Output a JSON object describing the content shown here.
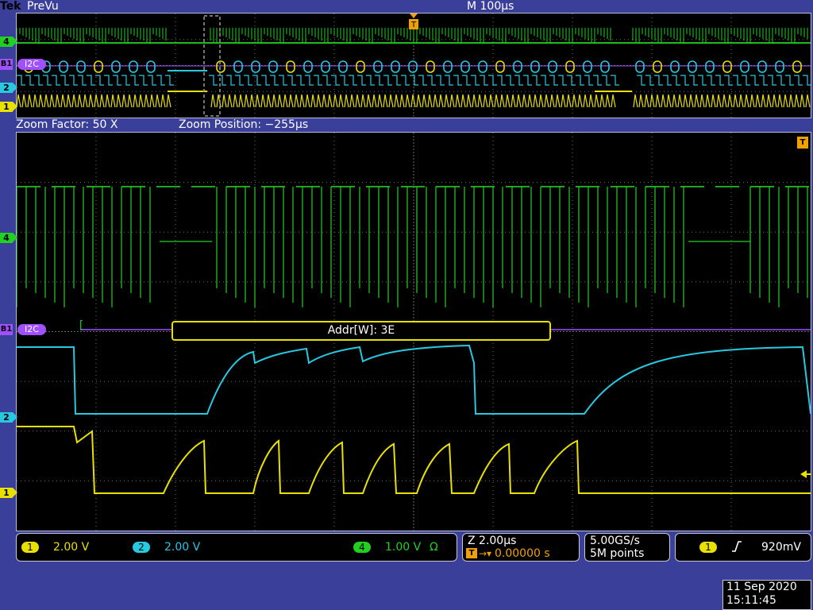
{
  "title_bar": {
    "brand": "Tek",
    "mode": "PreVu",
    "horizontal_scale": "M 100µs"
  },
  "trigger_flag": "T",
  "channels": [
    {
      "id": "1",
      "color": "#e8e000",
      "scale": "2.00 V"
    },
    {
      "id": "2",
      "color": "#28c8e0",
      "scale": "2.00 V"
    },
    {
      "id": "4",
      "color": "#22d022",
      "scale": "1.00 V",
      "coupling": "Ω"
    }
  ],
  "bus": {
    "id": "B1",
    "protocol": "I2C",
    "color": "#a050ff"
  },
  "zoom": {
    "factor_text": "Zoom Factor: 50 X",
    "position_text": "Zoom Position: −255µs"
  },
  "decode": {
    "start_bracket": "[",
    "packet_text": "Addr[W]: 3E"
  },
  "timebase_box": {
    "zoom_scale": "Z 2.00µs",
    "trigger_position": "0.00000 s"
  },
  "acquisition": {
    "sample_rate": "5.00GS/s",
    "record_length": "5M points"
  },
  "trigger": {
    "source": "1",
    "slope_icon": "rising-edge-icon",
    "level": "920mV"
  },
  "datetime": {
    "date": "11 Sep  2020",
    "time": "15:11:45"
  },
  "colors": {
    "graticule": "#6b6b6b",
    "accent_orange": "#f0a000",
    "bus_purple": "#a050ff",
    "background": "#3a3f9a"
  }
}
